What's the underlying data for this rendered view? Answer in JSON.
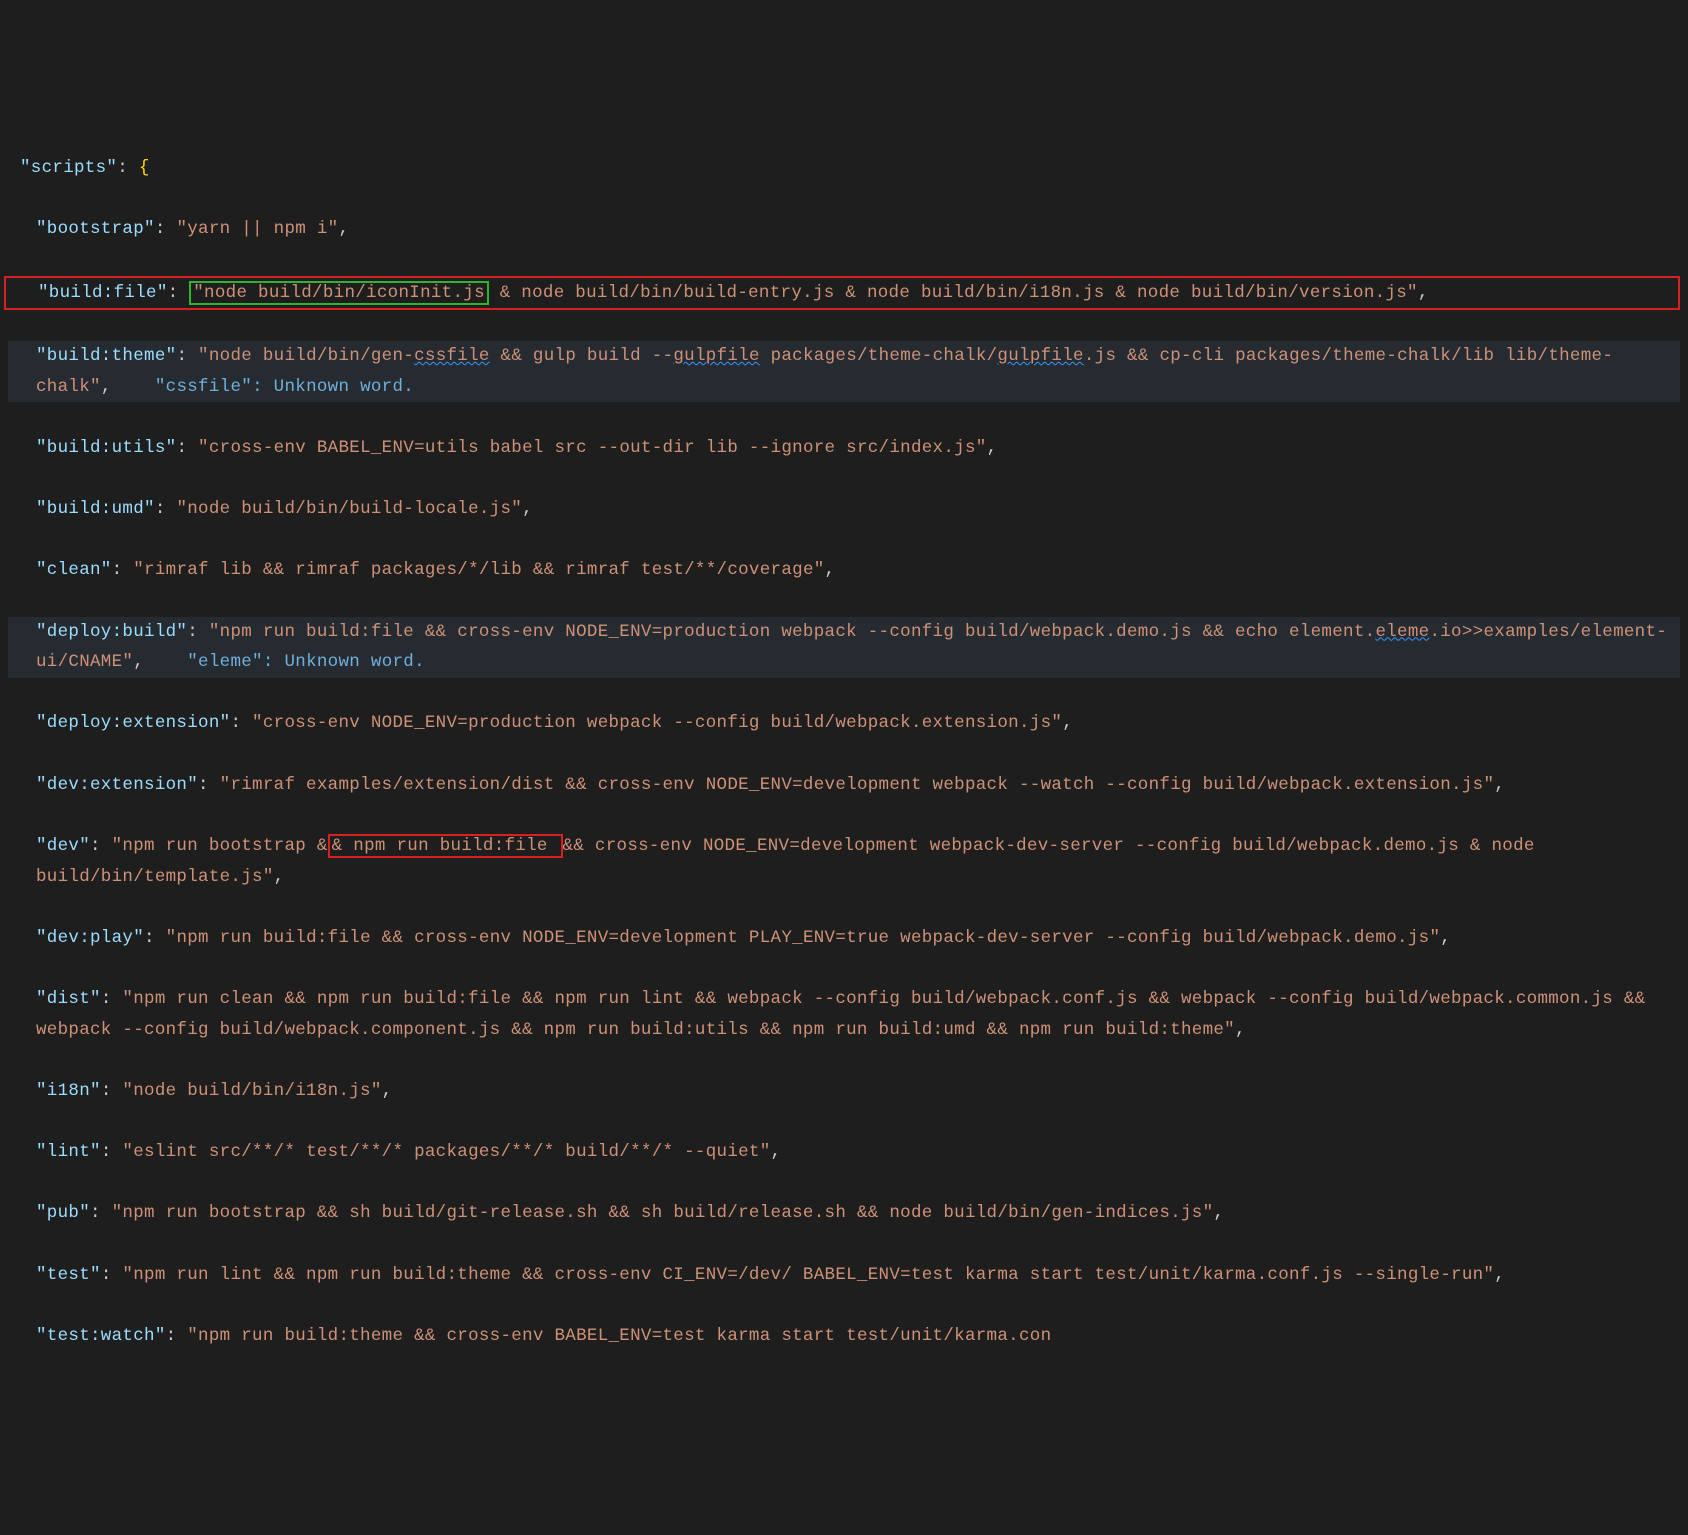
{
  "scripts": {
    "header_key": "\"scripts\"",
    "entries": [
      {
        "k": "\"bootstrap\"",
        "v": "\"yarn || npm i\""
      },
      {
        "k": "\"build:file\"",
        "v_green": "\"node build/bin/iconInit.js",
        "v_rest": " & node build/bin/build-entry.js & node build/bin/i18n.js & node build/bin/version.js\""
      },
      {
        "k": "\"build:theme\"",
        "v": "\"node build/bin/gen-cssfile && gulp build --gulpfile packages/theme-chalk/gulpfile.js && cp-cli packages/theme-chalk/lib lib/theme-chalk\"",
        "hint_key": "\"cssfile\"",
        "hint_msg": ": Unknown word.",
        "sq": [
          "cssfile",
          "gulpfile"
        ]
      },
      {
        "k": "\"build:utils\"",
        "v": "\"cross-env BABEL_ENV=utils babel src --out-dir lib --ignore src/index.js\""
      },
      {
        "k": "\"build:umd\"",
        "v": "\"node build/bin/build-locale.js\""
      },
      {
        "k": "\"clean\"",
        "v": "\"rimraf lib && rimraf packages/*/lib && rimraf test/**/coverage\""
      },
      {
        "k": "\"deploy:build\"",
        "v": "\"npm run build:file && cross-env NODE_ENV=production webpack --config build/webpack.demo.js && echo element.eleme.io>>examples/element-ui/CNAME\"",
        "hint_key": "\"eleme\"",
        "hint_msg": ": Unknown word.",
        "sq": [
          "eleme"
        ]
      },
      {
        "k": "\"deploy:extension\"",
        "v": "\"cross-env NODE_ENV=production webpack --config build/webpack.extension.js\""
      },
      {
        "k": "\"dev:extension\"",
        "v": "\"rimraf examples/extension/dist && cross-env NODE_ENV=development webpack --watch --config build/webpack.extension.js\""
      },
      {
        "k": "\"dev\"",
        "v_pre": "\"npm run bootstrap &",
        "v_box": "& npm run build:file ",
        "v_post": "&& cross-env NODE_ENV=development webpack-dev-server --config build/webpack.demo.js & node build/bin/template.js\""
      },
      {
        "k": "\"dev:play\"",
        "v": "\"npm run build:file && cross-env NODE_ENV=development PLAY_ENV=true webpack-dev-server --config build/webpack.demo.js\""
      },
      {
        "k": "\"dist\"",
        "v": "\"npm run clean && npm run build:file && npm run lint && webpack --config build/webpack.conf.js && webpack --config build/webpack.common.js && webpack --config build/webpack.component.js && npm run build:utils && npm run build:umd && npm run build:theme\""
      },
      {
        "k": "\"i18n\"",
        "v": "\"node build/bin/i18n.js\""
      },
      {
        "k": "\"lint\"",
        "v": "\"eslint src/**/* test/**/* packages/**/* build/**/* --quiet\""
      },
      {
        "k": "\"pub\"",
        "v": "\"npm run bootstrap && sh build/git-release.sh && sh build/release.sh && node build/bin/gen-indices.js\""
      },
      {
        "k": "\"test\"",
        "v": "\"npm run lint && npm run build:theme && cross-env CI_ENV=/dev/ BABEL_ENV=test karma start test/unit/karma.conf.js --single-run\""
      },
      {
        "k": "\"test:watch\"",
        "v": "\"npm run build:theme && cross-env BABEL_ENV=test karma start test/unit/karma.con"
      }
    ]
  }
}
